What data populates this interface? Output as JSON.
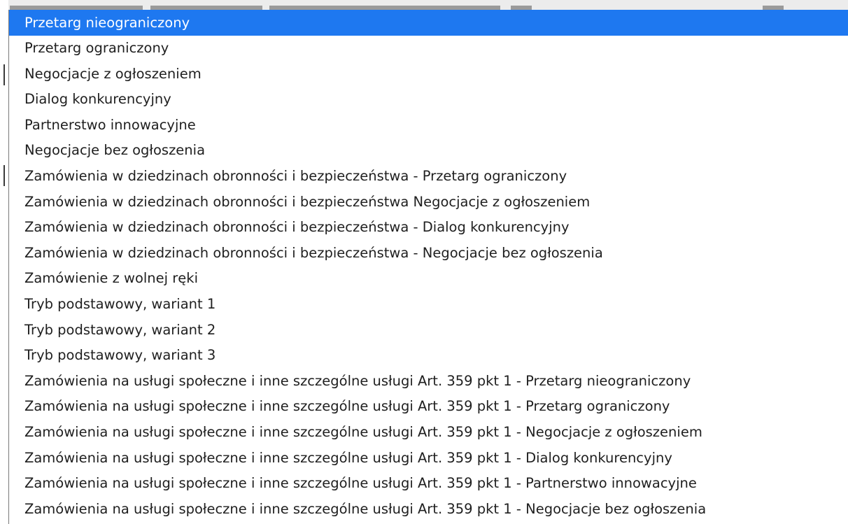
{
  "accent_color": "#1e78f0",
  "dropdown": {
    "selected_index": 0,
    "options": [
      "Przetarg nieograniczony",
      "Przetarg ograniczony",
      "Negocjacje z ogłoszeniem",
      "Dialog konkurencyjny",
      "Partnerstwo innowacyjne",
      "Negocjacje bez ogłoszenia",
      "Zamówienia w dziedzinach obronności i bezpieczeństwa - Przetarg ograniczony",
      "Zamówienia w dziedzinach obronności i bezpieczeństwa Negocjacje z ogłoszeniem",
      "Zamówienia w dziedzinach obronności i bezpieczeństwa - Dialog konkurencyjny",
      "Zamówienia w dziedzinach obronności i bezpieczeństwa - Negocjacje bez ogłoszenia",
      "Zamówienie z wolnej ręki",
      "Tryb podstawowy, wariant 1",
      "Tryb podstawowy, wariant 2",
      "Tryb podstawowy, wariant 3",
      "Zamówienia na usługi społeczne i inne szczególne usługi Art. 359 pkt 1 - Przetarg nieograniczony",
      "Zamówienia na usługi społeczne i inne szczególne usługi Art. 359 pkt 1 - Przetarg ograniczony",
      "Zamówienia na usługi społeczne i inne szczególne usługi Art. 359 pkt 1 - Negocjacje z ogłoszeniem",
      "Zamówienia na usługi społeczne i inne szczególne usługi Art. 359 pkt 1 - Dialog konkurencyjny",
      "Zamówienia na usługi społeczne i inne szczególne usługi Art. 359 pkt 1 - Partnerstwo innowacyjne",
      "Zamówienia na usługi społeczne i inne szczególne usługi Art. 359 pkt 1 - Negocjacje bez ogłoszenia"
    ]
  }
}
